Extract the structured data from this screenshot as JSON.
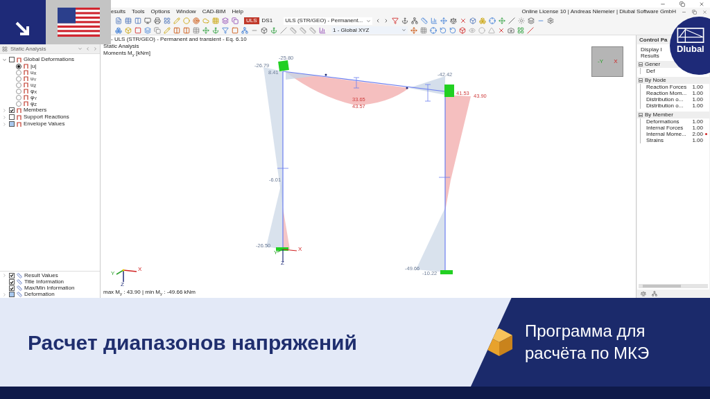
{
  "window": {
    "license": "Online License 10 | Andreas Niemeier | Dlubal Software GmbH"
  },
  "menu": {
    "items": [
      "esults",
      "Tools",
      "Options",
      "Window",
      "CAD-BIM",
      "Help"
    ]
  },
  "toolbar": {
    "load_badge": "ULS",
    "load_case": "DS1",
    "combination": "ULS (STR/GEO) - Permanent...",
    "coordinate_system": "1 - Global XYZ"
  },
  "navigator": {
    "title": "Static Analysis",
    "tree": [
      {
        "label": "Global Deformations",
        "checked": false,
        "indeterminate": false,
        "expanded": true,
        "children": [
          {
            "label": "|u|",
            "selected": true
          },
          {
            "label": "u$_{X}$",
            "selected": false
          },
          {
            "label": "u$_{Y}$",
            "selected": false
          },
          {
            "label": "u$_{Z}$",
            "selected": false
          },
          {
            "label": "φ$_{X}$",
            "selected": false
          },
          {
            "label": "φ$_{Y}$",
            "selected": false
          },
          {
            "label": "φ$_{Z}$",
            "selected": false
          }
        ]
      },
      {
        "label": "Members",
        "checked": true,
        "indeterminate": false,
        "expanded": false
      },
      {
        "label": "Support Reactions",
        "checked": false,
        "indeterminate": false,
        "expanded": false
      },
      {
        "label": "Envelope Values",
        "checked": false,
        "indeterminate": true,
        "expanded": false
      }
    ],
    "display": [
      {
        "label": "Result Values",
        "checked": true,
        "indeterminate": false,
        "expandable": true
      },
      {
        "label": "Title Information",
        "checked": true,
        "indeterminate": false,
        "expandable": false
      },
      {
        "label": "Max/Min Information",
        "checked": true,
        "indeterminate": false,
        "expandable": false
      },
      {
        "label": "Deformation",
        "checked": false,
        "indeterminate": true,
        "expandable": true
      }
    ]
  },
  "viewport": {
    "header": [
      "- ULS (STR/GEO) - Permanent and transient - Eq. 6.10",
      "Static Analysis",
      "Moments M$_{y}$ [kNm]"
    ],
    "labels": [
      {
        "text": "-25.80",
        "kind": "negative"
      },
      {
        "text": "-26.79",
        "kind": "negative"
      },
      {
        "text": "8.41",
        "kind": "negative"
      },
      {
        "text": "33.65",
        "kind": "positive"
      },
      {
        "text": "43.57",
        "kind": "positive"
      },
      {
        "text": "-42.42",
        "kind": "negative"
      },
      {
        "text": "41.53",
        "kind": "positive"
      },
      {
        "text": "43.90",
        "kind": "positive"
      },
      {
        "text": "-6.01",
        "kind": "negative"
      },
      {
        "text": "-26.50",
        "kind": "negative"
      },
      {
        "text": "-49.66",
        "kind": "negative"
      },
      {
        "text": "-10.22",
        "kind": "negative"
      }
    ],
    "support_axes": [
      {
        "label": "X",
        "kind": "x"
      },
      {
        "label": "Y",
        "kind": "y"
      },
      {
        "label": "Z",
        "kind": "z"
      }
    ],
    "global_axes": [
      {
        "label": "X",
        "kind": "x"
      },
      {
        "label": "Y",
        "kind": "y"
      },
      {
        "label": "Z",
        "kind": "z"
      }
    ],
    "cube_faces": [
      {
        "label": "-Y",
        "kind": "y"
      },
      {
        "label": "X",
        "kind": "x"
      }
    ],
    "footer": "max M$_{y}$ : 43.90 | min M$_{y}$ : -49.66 kNm"
  },
  "control_panel": {
    "title": "Control Pa",
    "display": "Display I",
    "results": "Results",
    "groups": [
      {
        "label": "Gener",
        "expanded": true,
        "rows": [
          {
            "label": "Def",
            "value": "",
            "marked": false
          }
        ]
      },
      {
        "label": "By Node",
        "expanded": true,
        "rows": [
          {
            "label": "Reaction Forces",
            "value": "1.00",
            "marked": false
          },
          {
            "label": "Reaction Mom...",
            "value": "1.00",
            "marked": false
          },
          {
            "label": "Distribution o...",
            "value": "1.00",
            "marked": false
          },
          {
            "label": "Distribution o...",
            "value": "1.00",
            "marked": false
          }
        ]
      },
      {
        "label": "By Member",
        "expanded": true,
        "rows": [
          {
            "label": "Deformations",
            "value": "1.00",
            "marked": false
          },
          {
            "label": "Internal Forces",
            "value": "1.00",
            "marked": false
          },
          {
            "label": "Internal Mome...",
            "value": "2.00",
            "marked": true
          },
          {
            "label": "Strains",
            "value": "1.00",
            "marked": false
          }
        ]
      }
    ]
  },
  "brand": {
    "logo": "Dlubal"
  },
  "banner": {
    "title": "Расчет диапазонов напряжений",
    "product": [
      "Программа для",
      "расчёта по МКЭ"
    ]
  }
}
